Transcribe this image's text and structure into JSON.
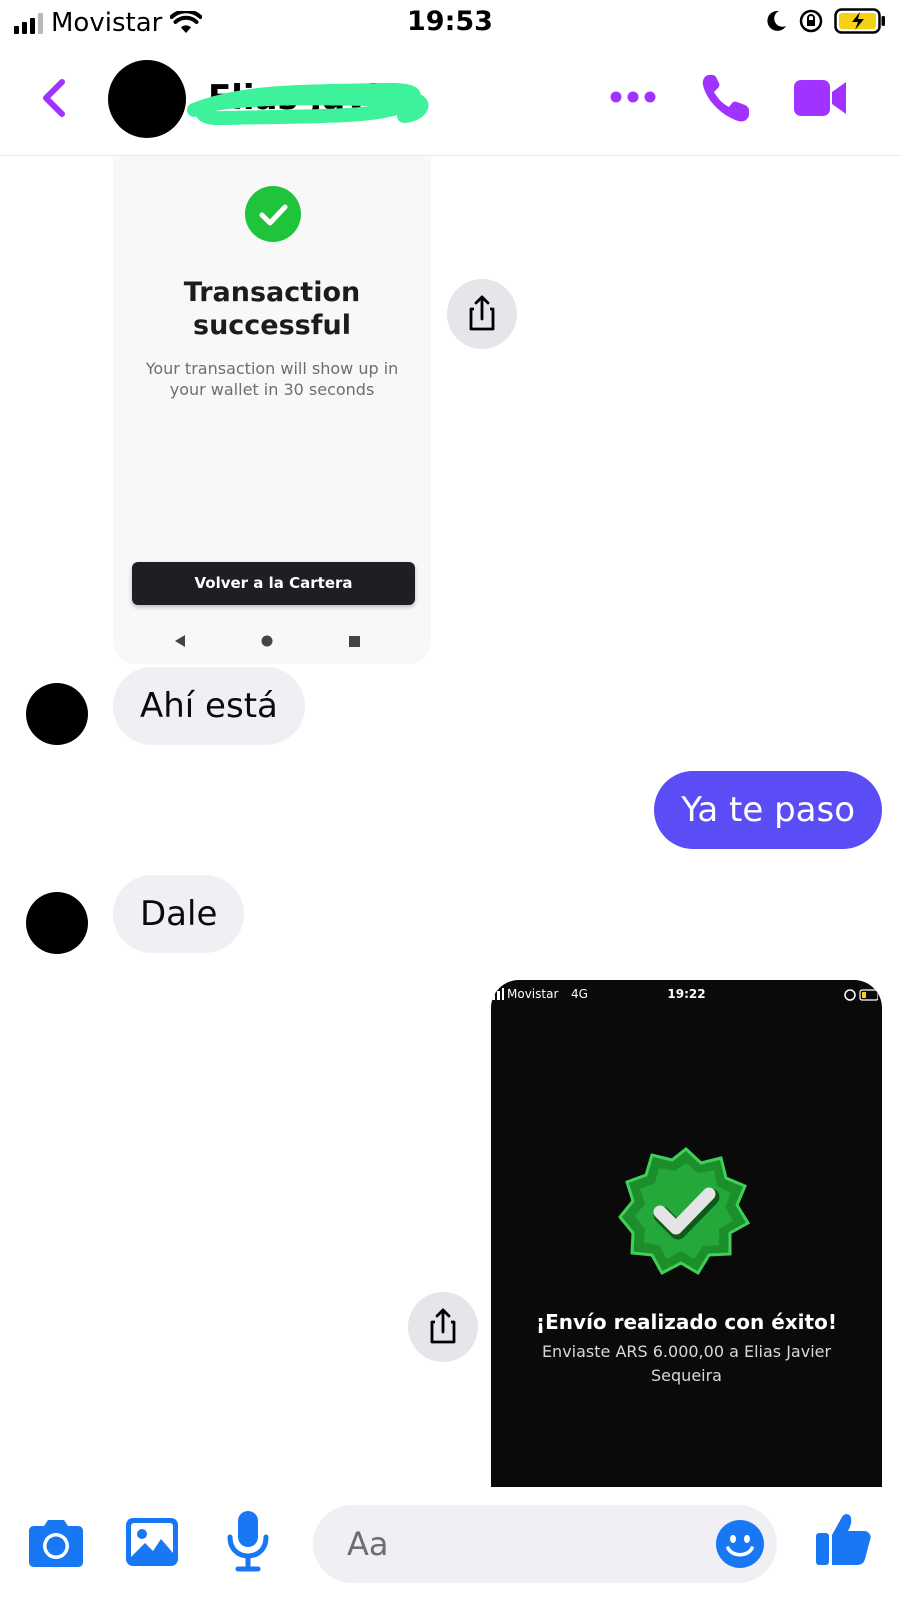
{
  "status_bar": {
    "carrier": "Movistar",
    "time": "19:53"
  },
  "header": {
    "contact_name": "Elias Javier"
  },
  "colors": {
    "accent": "#a033ff",
    "sent_bubble": "#5b4df6",
    "received_bubble": "#f0f0f4",
    "composer_icon": "#1877f2"
  },
  "icons": {
    "back": "chevron-left-icon",
    "more": "more-dots-icon",
    "call": "phone-icon",
    "video": "video-camera-icon",
    "share": "share-icon",
    "camera": "camera-icon",
    "gallery": "image-icon",
    "mic": "microphone-icon",
    "emoji": "smiley-icon",
    "like": "thumbs-up-icon"
  },
  "messages": {
    "image1": {
      "title": "Transaction successful",
      "subtitle": "Your transaction will show up in your wallet in 30 seconds",
      "button": "Volver a la Cartera"
    },
    "msg1": "Ahí está",
    "msg2": "Ya te paso",
    "msg3": "Dale",
    "image2": {
      "carrier": "Movistar",
      "network": "4G",
      "time": "19:22",
      "title": "¡Envío realizado con éxito!",
      "subtitle": "Enviaste ARS 6.000,00 a Elias Javier Sequeira"
    }
  },
  "composer": {
    "placeholder": "Aa"
  }
}
